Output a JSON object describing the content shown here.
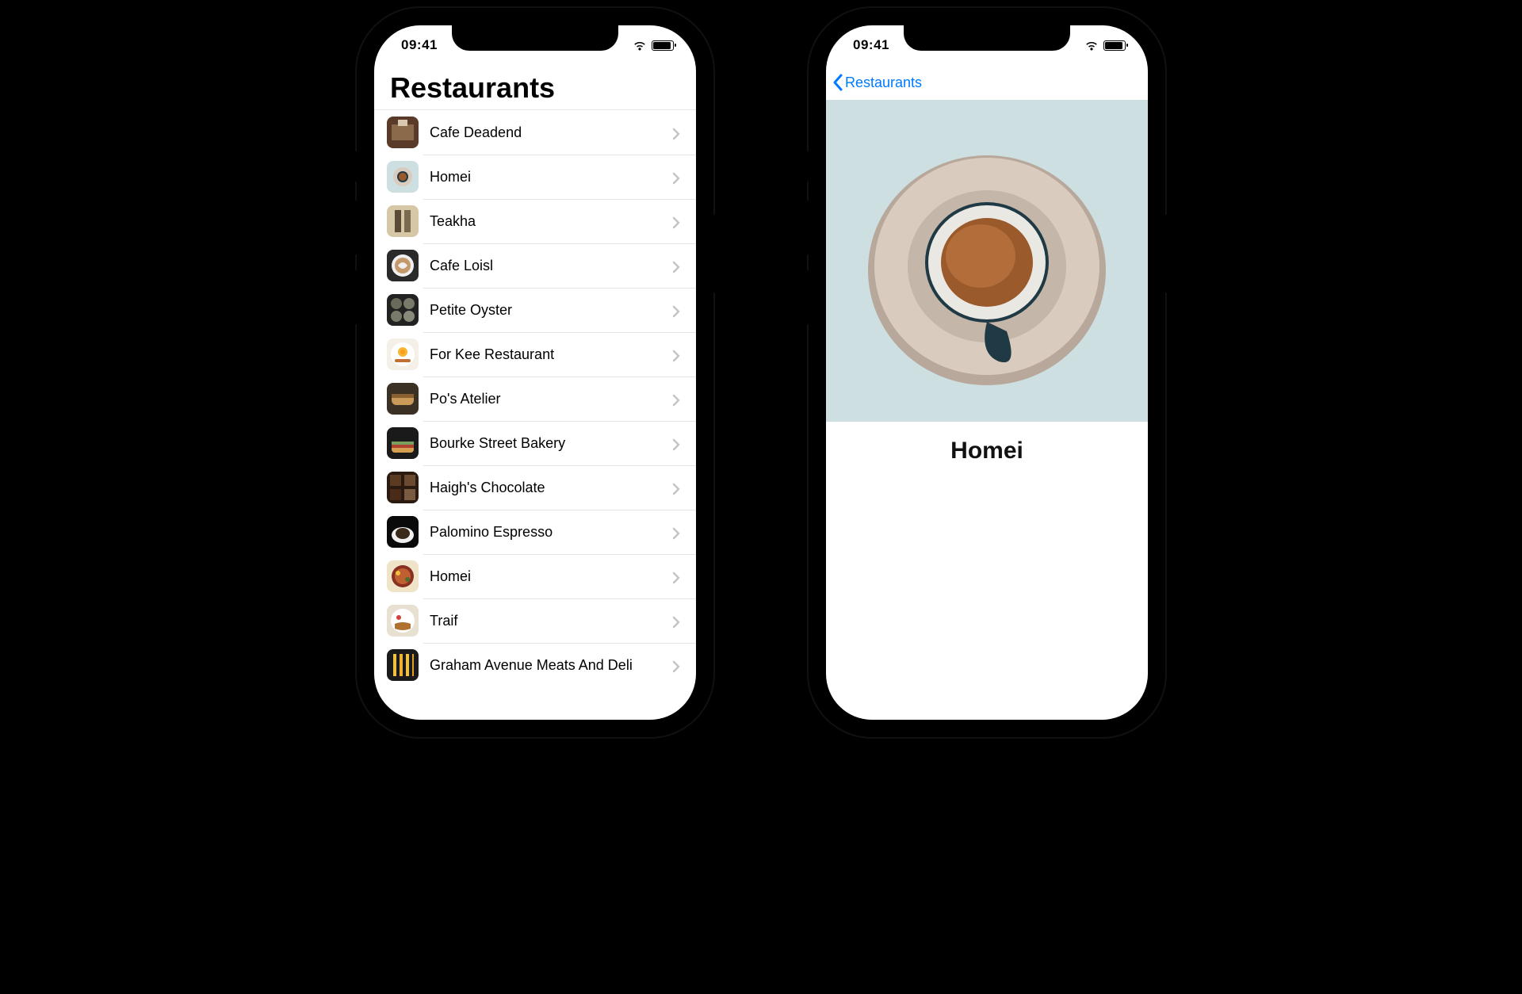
{
  "status": {
    "time": "09:41"
  },
  "list_screen": {
    "title": "Restaurants",
    "rows": [
      {
        "name": "Cafe Deadend"
      },
      {
        "name": "Homei"
      },
      {
        "name": "Teakha"
      },
      {
        "name": "Cafe Loisl"
      },
      {
        "name": "Petite Oyster"
      },
      {
        "name": "For Kee Restaurant"
      },
      {
        "name": "Po's Atelier"
      },
      {
        "name": "Bourke Street Bakery"
      },
      {
        "name": "Haigh's Chocolate"
      },
      {
        "name": "Palomino Espresso"
      },
      {
        "name": "Homei"
      },
      {
        "name": "Traif"
      },
      {
        "name": "Graham Avenue Meats And Deli"
      }
    ]
  },
  "detail_screen": {
    "back_label": "Restaurants",
    "title": "Homei"
  }
}
